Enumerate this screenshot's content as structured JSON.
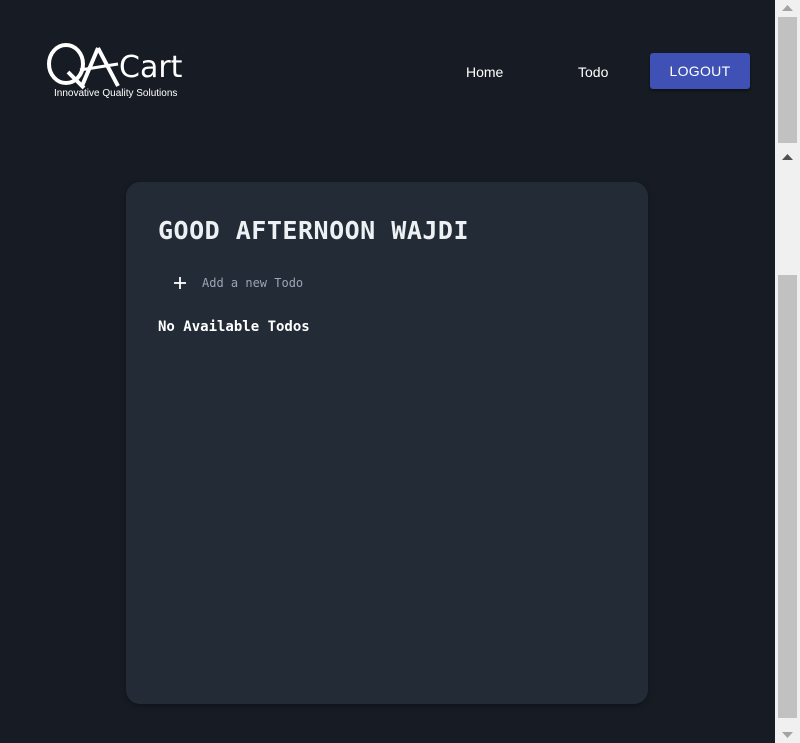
{
  "header": {
    "logo": {
      "text": "Cart",
      "tagline": "Innovative Quality Solutions"
    },
    "nav": {
      "home_label": "Home",
      "todo_label": "Todo"
    },
    "logout_label": "LOGOUT"
  },
  "main": {
    "greeting": "GOOD AFTERNOON WAJDI",
    "add_todo_label": "Add a new Todo",
    "empty_message": "No Available Todos"
  },
  "colors": {
    "background": "#171c24",
    "card": "#222b36",
    "accent": "#3f51b5",
    "muted_text": "#9aa6b6"
  },
  "icons": {
    "logo_mark": "qa-logo-icon",
    "add": "plus-icon",
    "scroll_up": "triangle-up-icon",
    "scroll_down": "triangle-down-icon"
  }
}
